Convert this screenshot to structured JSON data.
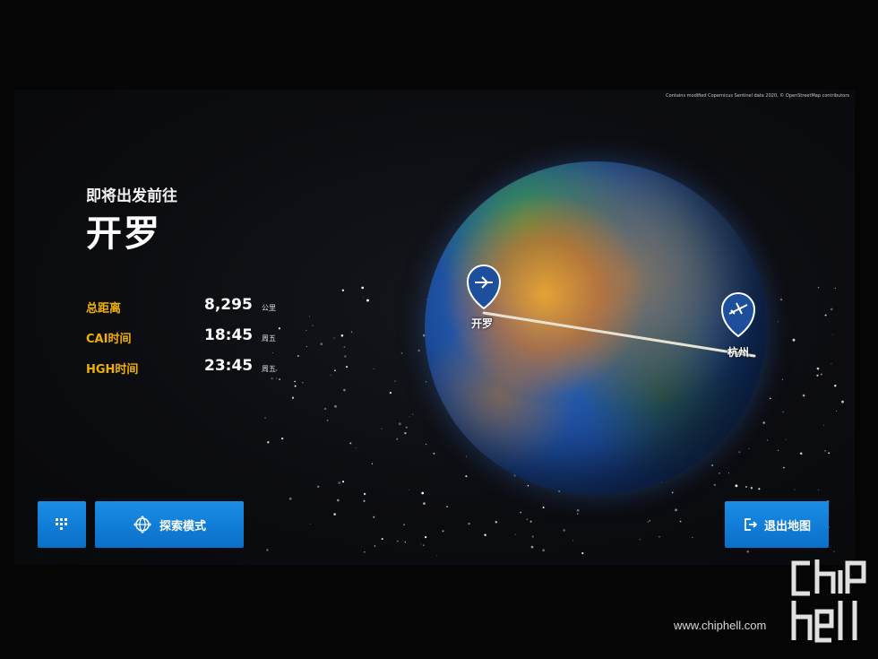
{
  "attribution": "Contains modified Copernicus Sentinel data 2020, © OpenStreetMap contributors",
  "heading": {
    "subtitle": "即将出发前往",
    "destination": "开罗"
  },
  "stats": [
    {
      "label": "总距离",
      "value": "8,295",
      "unit": "公里"
    },
    {
      "label": "CAI时间",
      "value": "18:45",
      "unit": "周五"
    },
    {
      "label": "HGH时间",
      "value": "23:45",
      "unit": "周五"
    }
  ],
  "buttons": {
    "grid_icon": "grid-icon",
    "explore_label": "探索模式",
    "explore_icon": "globe-icon",
    "exit_label": "退出地图",
    "exit_icon": "exit-icon"
  },
  "map": {
    "origin_label": "开罗",
    "dest_label": "杭州",
    "route_color": "#e8e2d2",
    "pin_color": "#1e4f9c"
  },
  "colors": {
    "accent_blue": "#1a8de6",
    "label_gold": "#f0b000"
  },
  "watermark": {
    "url": "www.chiphell.com",
    "logo_text": "chip hell"
  }
}
